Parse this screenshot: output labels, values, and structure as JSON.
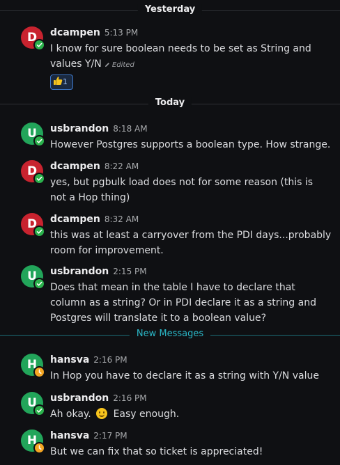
{
  "dividers": {
    "yesterday": "Yesterday",
    "today": "Today",
    "new_messages": "New Messages"
  },
  "messages": [
    {
      "author": "dcampen",
      "initial": "D",
      "time": "5:13 PM",
      "text": "I know for sure boolean needs to be set as String and values Y/N",
      "edited_label": "Edited",
      "reaction": {
        "emoji": "thumbs-up",
        "count": "1"
      }
    },
    {
      "author": "usbrandon",
      "initial": "U",
      "time": "8:18 AM",
      "text": "However Postgres supports a boolean type.  How strange."
    },
    {
      "author": "dcampen",
      "initial": "D",
      "time": "8:22 AM",
      "text": "yes, but pgbulk load does not for some reason (this is not a Hop thing)"
    },
    {
      "author": "dcampen",
      "initial": "D",
      "time": "8:32 AM",
      "text": "this was at least a carryover from the PDI days...probably room for improvement."
    },
    {
      "author": "usbrandon",
      "initial": "U",
      "time": "2:15 PM",
      "text": "Does that mean in the table I have to declare that column as a string?  Or in PDI declare it as a string and Postgres will translate it to a boolean value?"
    },
    {
      "author": "hansva",
      "initial": "H",
      "time": "2:16 PM",
      "text": "In Hop you have to declare it as a string with Y/N value"
    },
    {
      "author": "usbrandon",
      "initial": "U",
      "time": "2:16 PM",
      "text_before": "Ah okay.",
      "text_after": "Easy enough.",
      "emoji": "slightly-smiling-face"
    },
    {
      "author": "hansva",
      "initial": "H",
      "time": "2:17 PM",
      "text": "But we can fix that so ticket is appreciated!"
    }
  ],
  "colors": {
    "background": "#0f1013",
    "avatar_dcampen": "#c8232f",
    "avatar_green": "#22a55a",
    "status_online": "#2bb24c",
    "status_away": "#f5a623",
    "new_messages_accent": "#2ab7c7"
  }
}
